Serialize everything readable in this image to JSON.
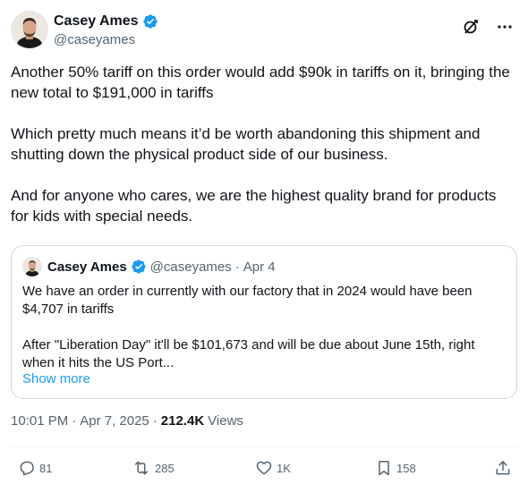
{
  "author": {
    "display_name": "Casey Ames",
    "handle": "@caseyames"
  },
  "post": {
    "paragraphs": [
      "Another 50% tariff on this order would add $90k in tariffs on it, bringing the new total to $191,000 in tariffs",
      "Which pretty much means it’d be worth abandoning this shipment and shutting down the physical product side of our business.",
      "And for anyone who cares, we are the highest quality brand for products for kids with special needs."
    ],
    "time": "10:01 PM",
    "date": "Apr 7, 2025",
    "views_count": "212.4K",
    "views_label": "Views"
  },
  "quoted": {
    "display_name": "Casey Ames",
    "handle": "@caseyames",
    "date": "Apr 4",
    "paragraphs": [
      "We have an order in currently with our factory that in 2024 would have been $4,707 in tariffs",
      "After \"Liberation Day\" it'll be $101,673 and will be due about June 15th, right when it hits the US Port..."
    ],
    "show_more": "Show more"
  },
  "actions": {
    "replies": "81",
    "reposts": "285",
    "likes": "1K",
    "bookmarks": "158"
  },
  "icons": {
    "verified": "verified-badge-icon",
    "grok": "grok-icon",
    "more": "more-icon",
    "reply": "reply-icon",
    "repost": "repost-icon",
    "like": "heart-icon",
    "bookmark": "bookmark-icon",
    "share": "share-icon"
  },
  "colors": {
    "verified": "#1d9bf0",
    "link": "#1d9bf0",
    "secondary_text": "#536471",
    "border": "#cfd9de"
  }
}
